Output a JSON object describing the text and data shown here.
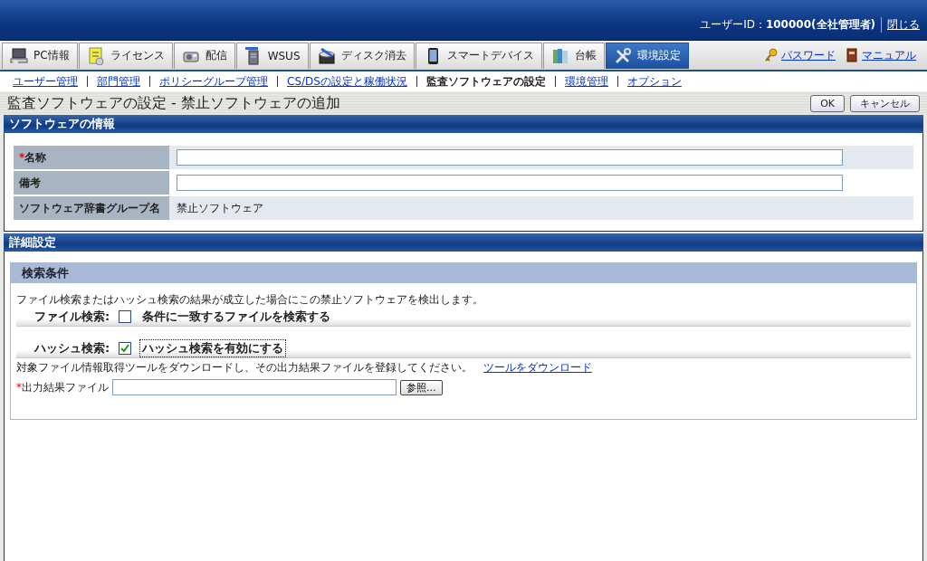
{
  "header": {
    "user_label": "ユーザーID：",
    "user_value": "100000(全社管理者)",
    "close_link": "閉じる"
  },
  "tabs": [
    {
      "label": "PC情報",
      "selected": false
    },
    {
      "label": "ライセンス",
      "selected": false
    },
    {
      "label": "配信",
      "selected": false
    },
    {
      "label": "WSUS",
      "selected": false
    },
    {
      "label": "ディスク消去",
      "selected": false
    },
    {
      "label": "スマートデバイス",
      "selected": false
    },
    {
      "label": "台帳",
      "selected": false
    },
    {
      "label": "環境設定",
      "selected": true
    }
  ],
  "tab_links": [
    "パスワード",
    "マニュアル"
  ],
  "subnav": [
    {
      "label": "ユーザー管理",
      "selected": false
    },
    {
      "label": "部門管理",
      "selected": false
    },
    {
      "label": "ポリシーグループ管理",
      "selected": false
    },
    {
      "label": "CS/DSの設定と稼働状況",
      "selected": false
    },
    {
      "label": "監査ソフトウェアの設定",
      "selected": true
    },
    {
      "label": "環境管理",
      "selected": false
    },
    {
      "label": "オプション",
      "selected": false
    }
  ],
  "page_title": "監査ソフトウェアの設定 - 禁止ソフトウェアの追加",
  "buttons": [
    "OK",
    "キャンセル"
  ],
  "info_section": {
    "title": "ソフトウェアの情報",
    "rows": [
      {
        "kind": "input",
        "mark": "*",
        "label": "名称"
      },
      {
        "kind": "input",
        "label": "備考"
      },
      {
        "kind": "text",
        "label": "ソフトウェア辞書グループ名",
        "value": "禁止ソフトウェア"
      }
    ]
  },
  "detail_section": {
    "title": "詳細設定",
    "panel_title": "検索条件",
    "description": "ファイル検索またはハッシュ検索の結果が成立した場合にこの禁止ソフトウェアを検出します。",
    "options": [
      {
        "heading": "ファイル検索:",
        "label": "条件に一致するファイルを検索する",
        "checked": false
      },
      {
        "heading": "ハッシュ検索:",
        "label": "ハッシュ検索を有効にする",
        "checked": true
      }
    ],
    "instruction": "対象ファイル情報取得ツールをダウンロードし、その出力結果ファイルを登録してください。",
    "download_link": "ツールをダウンロード",
    "file_field": {
      "mark": "*",
      "label": "出力結果ファイル",
      "button": "参照..."
    }
  }
}
